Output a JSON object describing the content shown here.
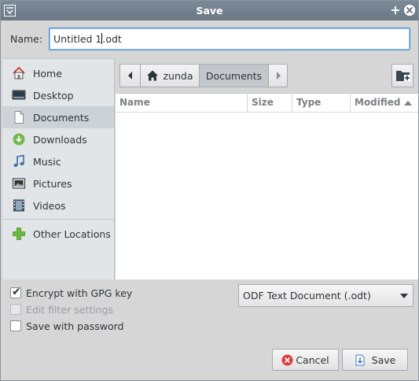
{
  "window": {
    "title": "Save"
  },
  "name_row": {
    "label": "Name:",
    "value_before_caret": "Untitled 1",
    "value_after_caret": ".odt"
  },
  "sidebar": {
    "items": [
      {
        "label": "Home",
        "icon": "home-icon"
      },
      {
        "label": "Desktop",
        "icon": "desktop-icon"
      },
      {
        "label": "Documents",
        "icon": "document-icon",
        "selected": true
      },
      {
        "label": "Downloads",
        "icon": "download-icon"
      },
      {
        "label": "Music",
        "icon": "music-icon"
      },
      {
        "label": "Pictures",
        "icon": "pictures-icon"
      },
      {
        "label": "Videos",
        "icon": "videos-icon"
      },
      {
        "label": "Other Locations",
        "icon": "plus-icon"
      }
    ]
  },
  "pathbar": {
    "segments": [
      "zunda",
      "Documents"
    ],
    "active": "Documents"
  },
  "filelist": {
    "columns": [
      "Name",
      "Size",
      "Type",
      "Modified"
    ],
    "sort_column": "Modified",
    "rows": []
  },
  "options": {
    "encrypt": {
      "label": "Encrypt with GPG key",
      "checked": true,
      "enabled": true
    },
    "edit_filter": {
      "label": "Edit filter settings",
      "checked": false,
      "enabled": false
    },
    "save_password": {
      "label": "Save with password",
      "checked": false,
      "enabled": true
    }
  },
  "filter": {
    "selected": "ODF Text Document (.odt)"
  },
  "buttons": {
    "cancel": "Cancel",
    "save": "Save"
  },
  "colors": {
    "titlebar": "#6e7c8a",
    "focus": "#4a90d9",
    "cancel_icon": "#e0393e",
    "save_icon": "#3a7cc4",
    "downloads": "#73b94a",
    "other_locations": "#6aba3f"
  }
}
